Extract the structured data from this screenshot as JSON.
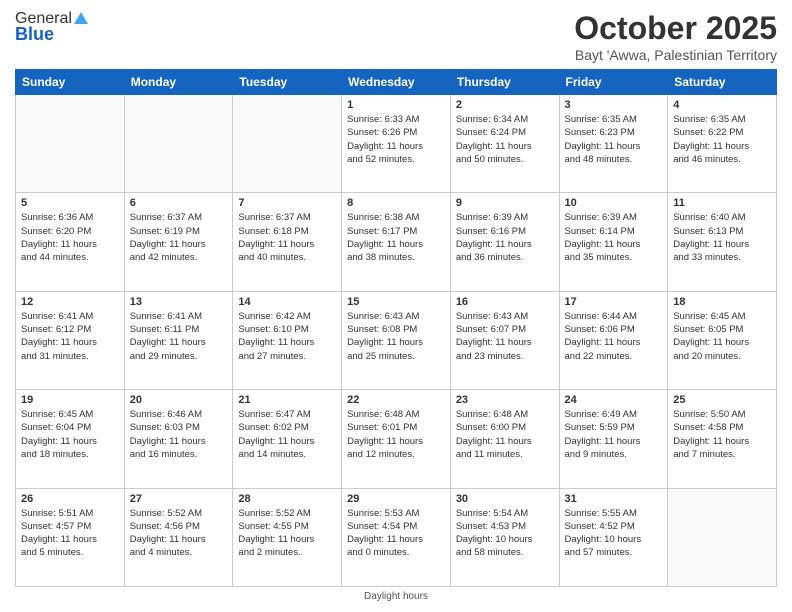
{
  "header": {
    "logo_general": "General",
    "logo_blue": "Blue",
    "title": "October 2025",
    "subtitle": "Bayt 'Awwa, Palestinian Territory"
  },
  "days_of_week": [
    "Sunday",
    "Monday",
    "Tuesday",
    "Wednesday",
    "Thursday",
    "Friday",
    "Saturday"
  ],
  "weeks": [
    [
      {
        "day": "",
        "info": ""
      },
      {
        "day": "",
        "info": ""
      },
      {
        "day": "",
        "info": ""
      },
      {
        "day": "1",
        "info": "Sunrise: 6:33 AM\nSunset: 6:26 PM\nDaylight: 11 hours\nand 52 minutes."
      },
      {
        "day": "2",
        "info": "Sunrise: 6:34 AM\nSunset: 6:24 PM\nDaylight: 11 hours\nand 50 minutes."
      },
      {
        "day": "3",
        "info": "Sunrise: 6:35 AM\nSunset: 6:23 PM\nDaylight: 11 hours\nand 48 minutes."
      },
      {
        "day": "4",
        "info": "Sunrise: 6:35 AM\nSunset: 6:22 PM\nDaylight: 11 hours\nand 46 minutes."
      }
    ],
    [
      {
        "day": "5",
        "info": "Sunrise: 6:36 AM\nSunset: 6:20 PM\nDaylight: 11 hours\nand 44 minutes."
      },
      {
        "day": "6",
        "info": "Sunrise: 6:37 AM\nSunset: 6:19 PM\nDaylight: 11 hours\nand 42 minutes."
      },
      {
        "day": "7",
        "info": "Sunrise: 6:37 AM\nSunset: 6:18 PM\nDaylight: 11 hours\nand 40 minutes."
      },
      {
        "day": "8",
        "info": "Sunrise: 6:38 AM\nSunset: 6:17 PM\nDaylight: 11 hours\nand 38 minutes."
      },
      {
        "day": "9",
        "info": "Sunrise: 6:39 AM\nSunset: 6:16 PM\nDaylight: 11 hours\nand 36 minutes."
      },
      {
        "day": "10",
        "info": "Sunrise: 6:39 AM\nSunset: 6:14 PM\nDaylight: 11 hours\nand 35 minutes."
      },
      {
        "day": "11",
        "info": "Sunrise: 6:40 AM\nSunset: 6:13 PM\nDaylight: 11 hours\nand 33 minutes."
      }
    ],
    [
      {
        "day": "12",
        "info": "Sunrise: 6:41 AM\nSunset: 6:12 PM\nDaylight: 11 hours\nand 31 minutes."
      },
      {
        "day": "13",
        "info": "Sunrise: 6:41 AM\nSunset: 6:11 PM\nDaylight: 11 hours\nand 29 minutes."
      },
      {
        "day": "14",
        "info": "Sunrise: 6:42 AM\nSunset: 6:10 PM\nDaylight: 11 hours\nand 27 minutes."
      },
      {
        "day": "15",
        "info": "Sunrise: 6:43 AM\nSunset: 6:08 PM\nDaylight: 11 hours\nand 25 minutes."
      },
      {
        "day": "16",
        "info": "Sunrise: 6:43 AM\nSunset: 6:07 PM\nDaylight: 11 hours\nand 23 minutes."
      },
      {
        "day": "17",
        "info": "Sunrise: 6:44 AM\nSunset: 6:06 PM\nDaylight: 11 hours\nand 22 minutes."
      },
      {
        "day": "18",
        "info": "Sunrise: 6:45 AM\nSunset: 6:05 PM\nDaylight: 11 hours\nand 20 minutes."
      }
    ],
    [
      {
        "day": "19",
        "info": "Sunrise: 6:45 AM\nSunset: 6:04 PM\nDaylight: 11 hours\nand 18 minutes."
      },
      {
        "day": "20",
        "info": "Sunrise: 6:46 AM\nSunset: 6:03 PM\nDaylight: 11 hours\nand 16 minutes."
      },
      {
        "day": "21",
        "info": "Sunrise: 6:47 AM\nSunset: 6:02 PM\nDaylight: 11 hours\nand 14 minutes."
      },
      {
        "day": "22",
        "info": "Sunrise: 6:48 AM\nSunset: 6:01 PM\nDaylight: 11 hours\nand 12 minutes."
      },
      {
        "day": "23",
        "info": "Sunrise: 6:48 AM\nSunset: 6:00 PM\nDaylight: 11 hours\nand 11 minutes."
      },
      {
        "day": "24",
        "info": "Sunrise: 6:49 AM\nSunset: 5:59 PM\nDaylight: 11 hours\nand 9 minutes."
      },
      {
        "day": "25",
        "info": "Sunrise: 5:50 AM\nSunset: 4:58 PM\nDaylight: 11 hours\nand 7 minutes."
      }
    ],
    [
      {
        "day": "26",
        "info": "Sunrise: 5:51 AM\nSunset: 4:57 PM\nDaylight: 11 hours\nand 5 minutes."
      },
      {
        "day": "27",
        "info": "Sunrise: 5:52 AM\nSunset: 4:56 PM\nDaylight: 11 hours\nand 4 minutes."
      },
      {
        "day": "28",
        "info": "Sunrise: 5:52 AM\nSunset: 4:55 PM\nDaylight: 11 hours\nand 2 minutes."
      },
      {
        "day": "29",
        "info": "Sunrise: 5:53 AM\nSunset: 4:54 PM\nDaylight: 11 hours\nand 0 minutes."
      },
      {
        "day": "30",
        "info": "Sunrise: 5:54 AM\nSunset: 4:53 PM\nDaylight: 10 hours\nand 58 minutes."
      },
      {
        "day": "31",
        "info": "Sunrise: 5:55 AM\nSunset: 4:52 PM\nDaylight: 10 hours\nand 57 minutes."
      },
      {
        "day": "",
        "info": ""
      }
    ]
  ],
  "footer": {
    "note": "Daylight hours"
  }
}
